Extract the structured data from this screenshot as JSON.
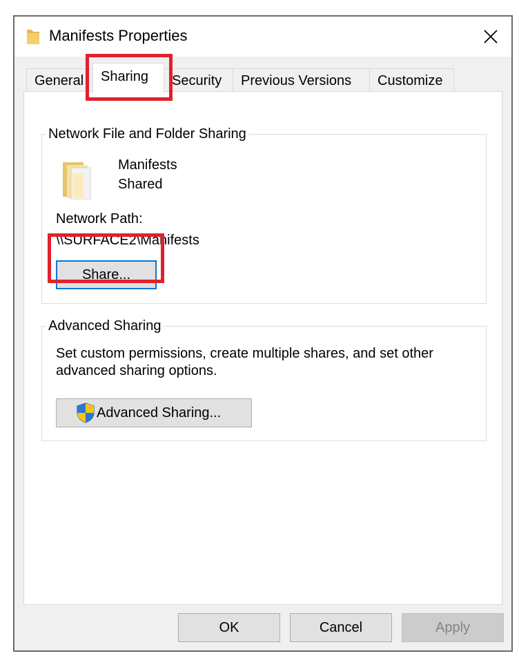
{
  "window": {
    "title": "Manifests Properties",
    "close_icon": "close-icon",
    "title_icon": "folder-icon"
  },
  "tabs": [
    {
      "label": "General",
      "active": false
    },
    {
      "label": "Sharing",
      "active": true
    },
    {
      "label": "Security",
      "active": false
    },
    {
      "label": "Previous Versions",
      "active": false
    },
    {
      "label": "Customize",
      "active": false
    }
  ],
  "network_sharing": {
    "group_title": "Network File and Folder Sharing",
    "folder_name": "Manifests",
    "status": "Shared",
    "path_label": "Network Path:",
    "path_value": "\\\\SURFACE2\\Manifests",
    "share_button": "Share..."
  },
  "advanced_sharing": {
    "group_title": "Advanced Sharing",
    "description_line1": "Set custom permissions, create multiple shares, and set other",
    "description_line2": "advanced sharing options.",
    "button_label": "Advanced Sharing...",
    "button_icon": "uac-shield-icon"
  },
  "footer": {
    "ok": "OK",
    "cancel": "Cancel",
    "apply": "Apply"
  },
  "colors": {
    "highlight": "#e0212e",
    "focus": "#0078d7"
  }
}
